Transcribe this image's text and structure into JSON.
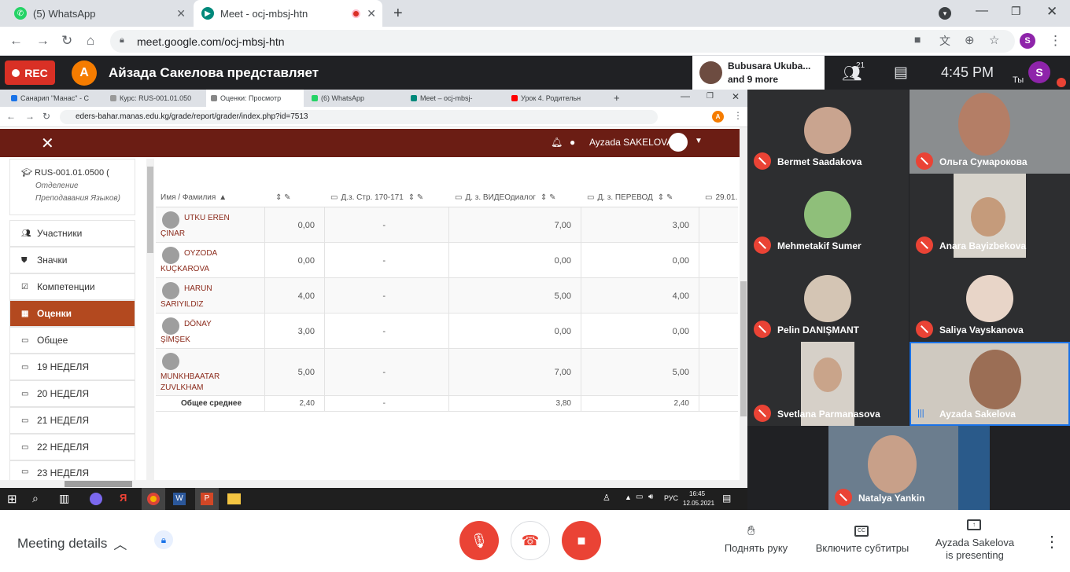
{
  "browser": {
    "tabs": [
      {
        "title": "(5) WhatsApp",
        "active": false
      },
      {
        "title": "Meet - ocj-mbsj-htn",
        "active": true
      }
    ],
    "url": "meet.google.com/ocj-mbsj-htn",
    "profile_initial": "S"
  },
  "meet_header": {
    "rec_label": "REC",
    "presenter_initial": "A",
    "presenter_text": "Айзада Сакелова представляет",
    "participant_preview_name": "Bubusara Ukuba...",
    "participant_preview_more": "and 9 more",
    "people_count": "21",
    "time": "4:45 PM",
    "self_label": "Ты",
    "self_initial": "S"
  },
  "shared_screen": {
    "inner_tabs": [
      "Санарип \"Манас\" - С",
      "Курс: RUS-001.01.050",
      "Оценки: Просмотр",
      "(6) WhatsApp",
      "Meet – ocj-mbsj-",
      "Урок 4. Родительн"
    ],
    "inner_url": "eders-bahar.manas.edu.kg/grade/report/grader/index.php?id=7513",
    "inner_profile_initial": "A",
    "moodle_user": "Ayzada SAKELOVA",
    "course": {
      "code": "RUS-001.01.0500 (",
      "dept_line1": "Отделение",
      "dept_line2": "Преподавания Языков)"
    },
    "sidebar": [
      {
        "label": "Участники",
        "icon": "users-icon"
      },
      {
        "label": "Значки",
        "icon": "shield-icon"
      },
      {
        "label": "Компетенции",
        "icon": "checkbox-icon"
      },
      {
        "label": "Оценки",
        "icon": "table-icon",
        "active": true
      },
      {
        "label": "Общее",
        "icon": "folder-icon"
      },
      {
        "label": "19 НЕДЕЛЯ",
        "icon": "folder-icon"
      },
      {
        "label": "20 НЕДЕЛЯ",
        "icon": "folder-icon"
      },
      {
        "label": "21 НЕДЕЛЯ",
        "icon": "folder-icon"
      },
      {
        "label": "22 НЕДЕЛЯ",
        "icon": "folder-icon"
      },
      {
        "label": "23 НЕДЕЛЯ",
        "icon": "folder-icon"
      }
    ],
    "table": {
      "headers": [
        "Имя / Фамилия",
        "",
        "Д.з. Стр. 170-171",
        "Д. з. ВИДЕОдиалог",
        "Д. з. ПЕРЕВОД",
        "29.01."
      ],
      "rows": [
        {
          "name1": "UTKU EREN",
          "name2": "ÇINAR",
          "c1": "0,00",
          "c2": "-",
          "c3": "7,00",
          "c4": "3,00"
        },
        {
          "name1": "OYZODA",
          "name2": "KUÇKAROVA",
          "c1": "0,00",
          "c2": "-",
          "c3": "0,00",
          "c4": "0,00"
        },
        {
          "name1": "HARUN",
          "name2": "SARIYILDIZ",
          "c1": "4,00",
          "c2": "-",
          "c3": "5,00",
          "c4": "4,00"
        },
        {
          "name1": "DÖNAY",
          "name2": "ŞİMŞEK",
          "c1": "3,00",
          "c2": "-",
          "c3": "0,00",
          "c4": "0,00"
        },
        {
          "name1": "MUNKHBAATAR",
          "name2": "ZUVLKHAM",
          "c1": "5,00",
          "c2": "-",
          "c3": "7,00",
          "c4": "5,00"
        }
      ],
      "average": {
        "label": "Общее среднее",
        "c1": "2,40",
        "c2": "-",
        "c3": "3,80",
        "c4": "2,40"
      }
    },
    "taskbar": {
      "lang": "РУС",
      "time": "16:45",
      "date": "12.05.2021"
    }
  },
  "participants": [
    {
      "name": "Bermet Saadakova",
      "muted": true
    },
    {
      "name": "Ольга Сумарокова",
      "muted": true
    },
    {
      "name": "Mehmetakif Sumer",
      "muted": true
    },
    {
      "name": "Anara Bayizbekova",
      "muted": true
    },
    {
      "name": "Pelin DANIŞMANT",
      "muted": true
    },
    {
      "name": "Saliya Vayskanova",
      "muted": true
    },
    {
      "name": "Svetlana Parmanasova",
      "muted": true
    },
    {
      "name": "Ayzada Sakelova",
      "muted": false
    },
    {
      "name": "Natalya Yankin",
      "muted": true
    }
  ],
  "bottom_bar": {
    "meeting_details": "Meeting details",
    "raise_hand": "Поднять руку",
    "captions": "Включите субтитры",
    "presenting_line1": "Ayzada Sakelova",
    "presenting_line2": "is presenting"
  },
  "colors": {
    "moodle_header": "#6b1d14",
    "active_sidebar": "#b3491f",
    "rec": "#d93025",
    "mute_red": "#ea4335",
    "meet_dark": "#202124"
  }
}
